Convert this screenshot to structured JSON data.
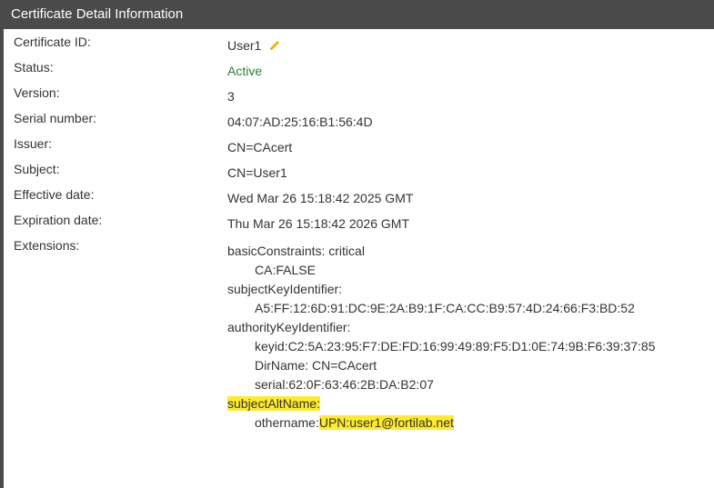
{
  "window": {
    "title": "Certificate Detail Information"
  },
  "fields": {
    "certificate_id": {
      "label": "Certificate ID:",
      "value": "User1"
    },
    "status": {
      "label": "Status:",
      "value": "Active"
    },
    "version": {
      "label": "Version:",
      "value": "3"
    },
    "serial": {
      "label": "Serial number:",
      "value": "04:07:AD:25:16:B1:56:4D"
    },
    "issuer": {
      "label": "Issuer:",
      "value": "CN=CAcert"
    },
    "subject": {
      "label": "Subject:",
      "value": "CN=User1"
    },
    "effective": {
      "label": "Effective date:",
      "value": "Wed Mar 26 15:18:42 2025 GMT"
    },
    "expiration": {
      "label": "Expiration date:",
      "value": "Thu Mar 26 15:18:42 2026 GMT"
    },
    "extensions": {
      "label": "Extensions:"
    }
  },
  "extensions": {
    "basic_constraints": "basicConstraints: critical",
    "basic_constraints_value": "CA:FALSE",
    "subject_key_identifier": "subjectKeyIdentifier:",
    "subject_key_identifier_value": "A5:FF:12:6D:91:DC:9E:2A:B9:1F:CA:CC:B9:57:4D:24:66:F3:BD:52",
    "authority_key_identifier": "authorityKeyIdentifier:",
    "keyid": "keyid:C2:5A:23:95:F7:DE:FD:16:99:49:89:F5:D1:0E:74:9B:F6:39:37:85",
    "dirname": "DirName: CN=CAcert",
    "serial": "serial:62:0F:63:46:2B:DA:B2:07",
    "subject_alt_name": "subjectAltName:",
    "othername_prefix": "othername:",
    "othername_upn": "UPN:user1@fortilab.net"
  },
  "colors": {
    "titlebar": "#4a4a4a",
    "active": "#2e7d32",
    "highlight": "#ffeb2b",
    "edit_icon": "#f0b400"
  },
  "icons": {
    "edit": "pencil-icon"
  }
}
